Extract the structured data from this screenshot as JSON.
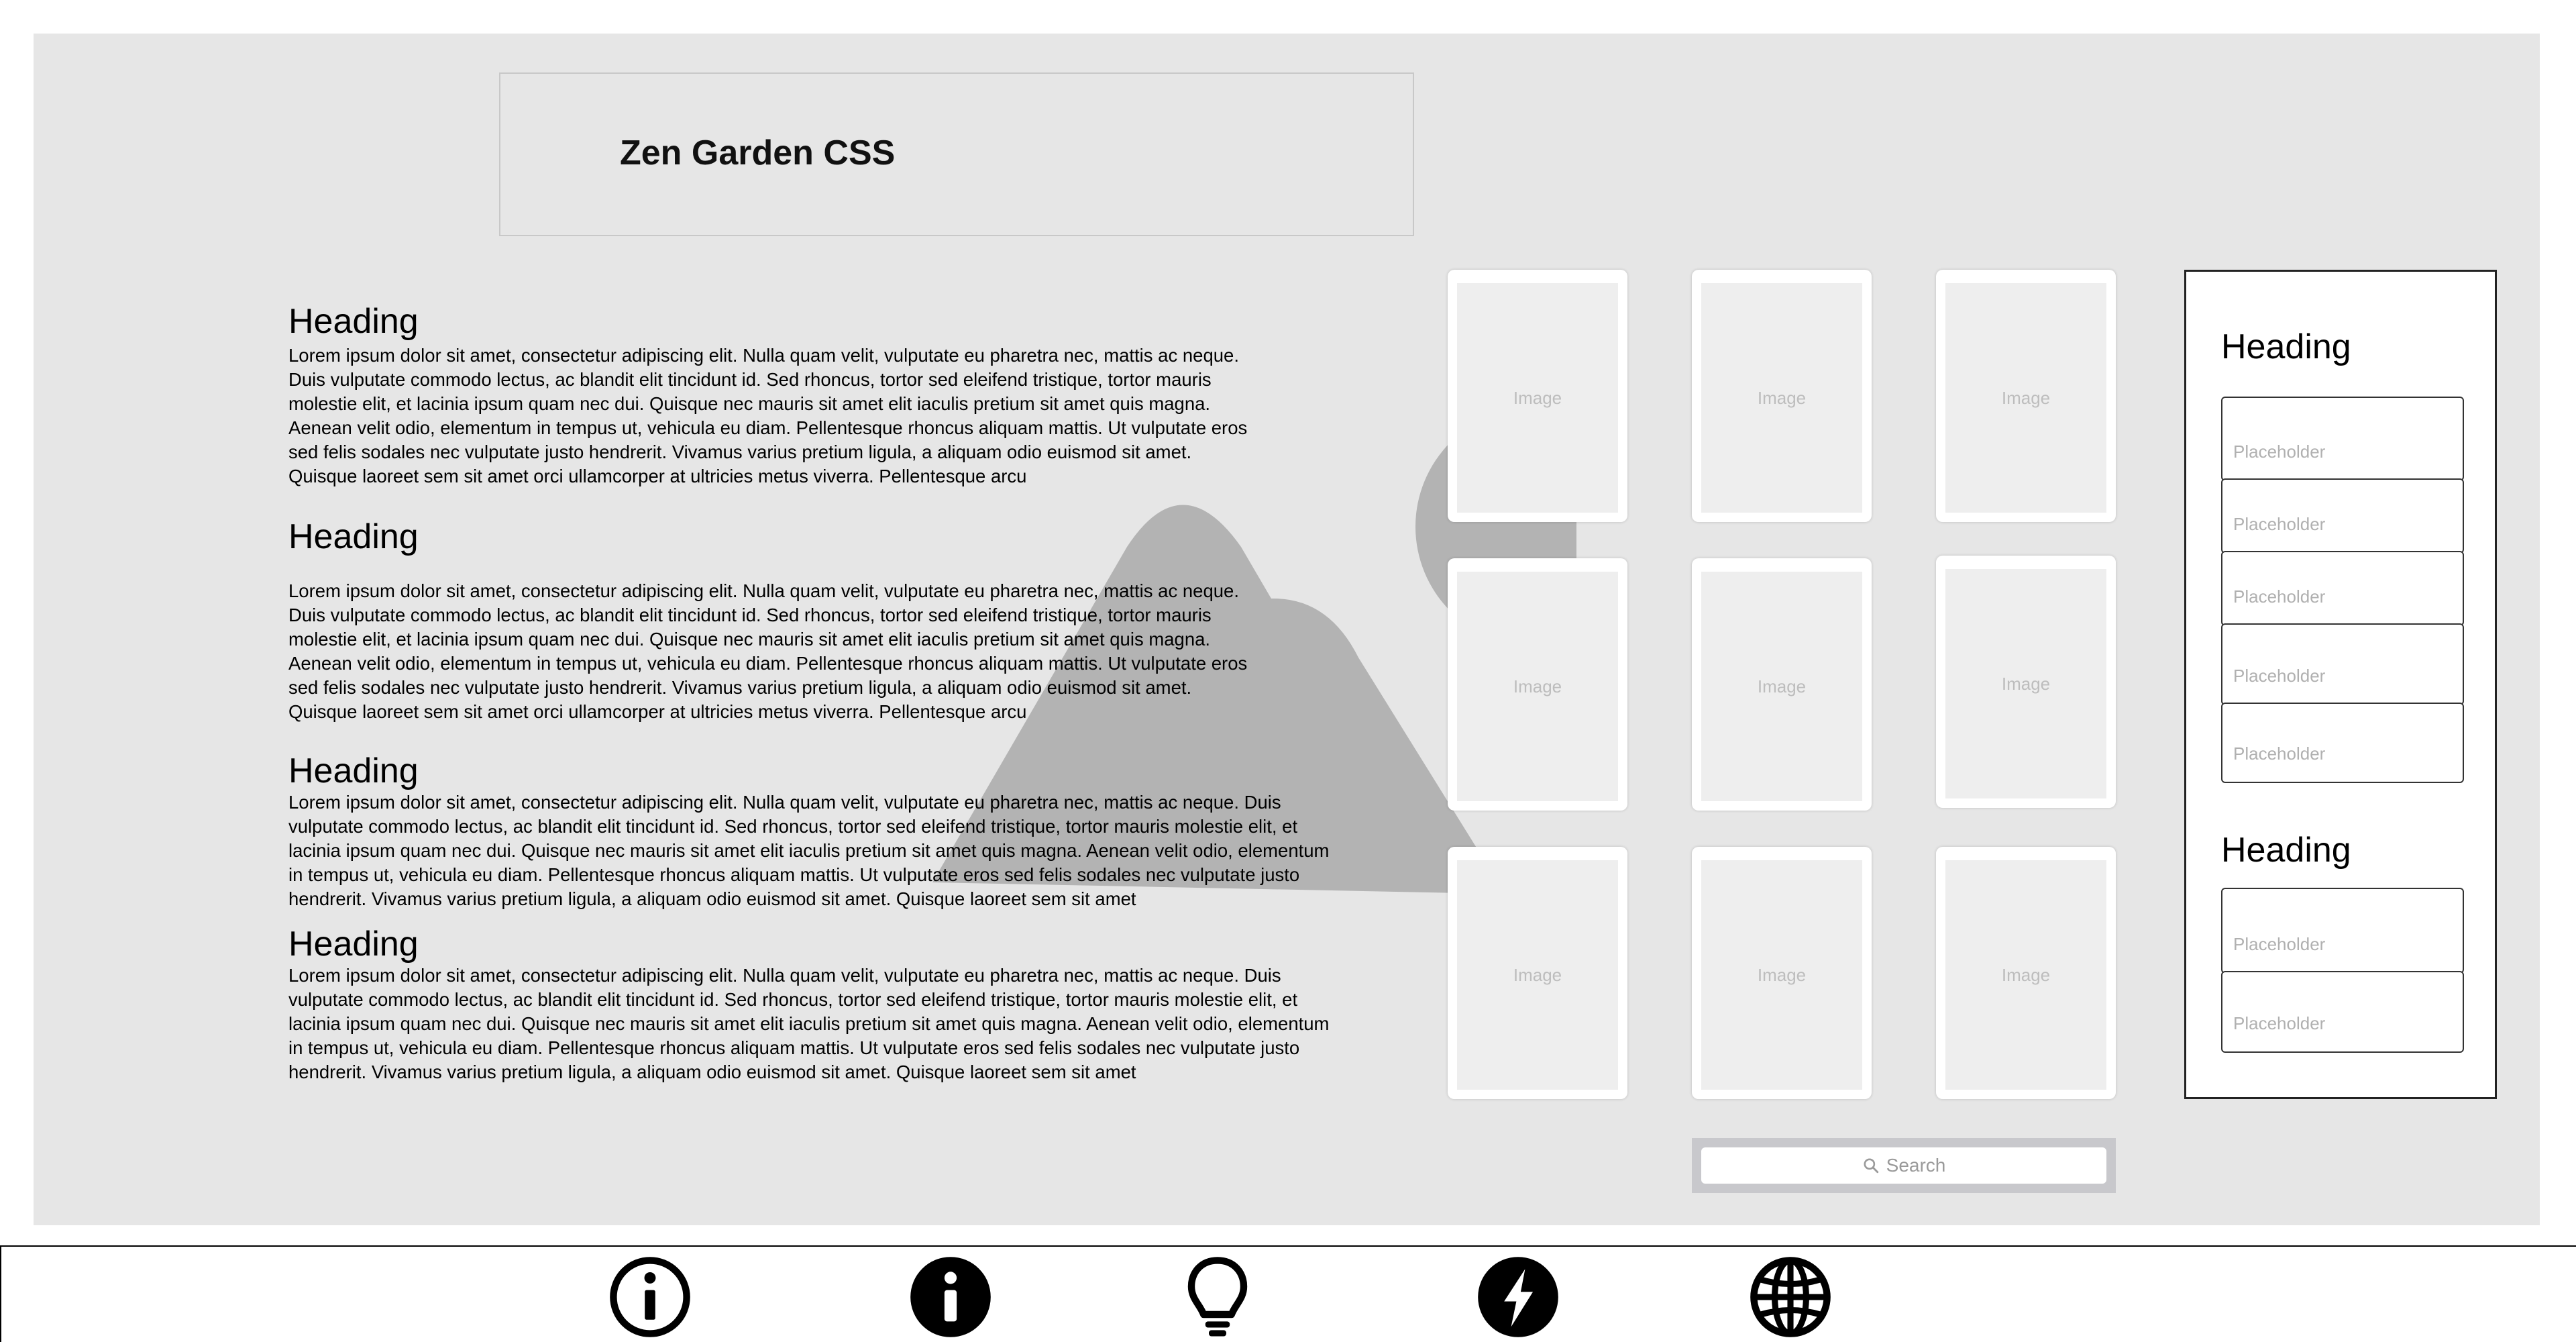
{
  "header": {
    "title": "Zen Garden CSS"
  },
  "articles": [
    {
      "heading": "Heading",
      "text": "Lorem ipsum dolor sit amet, consectetur adipiscing elit. Nulla quam velit, vulputate eu pharetra nec, mattis ac neque. Duis vulputate commodo lectus, ac blandit elit tincidunt id. Sed rhoncus, tortor sed eleifend tristique, tortor mauris molestie elit, et lacinia ipsum quam nec dui. Quisque nec mauris sit amet elit iaculis pretium sit amet quis magna. Aenean velit odio, elementum in tempus ut, vehicula eu diam. Pellentesque rhoncus aliquam mattis. Ut vulputate eros sed felis sodales nec vulputate justo hendrerit. Vivamus varius pretium ligula, a aliquam odio euismod sit amet. Quisque laoreet sem sit amet orci ullamcorper at ultricies metus viverra. Pellentesque arcu"
    },
    {
      "heading": "Heading",
      "text": "Lorem ipsum dolor sit amet, consectetur adipiscing elit. Nulla quam velit, vulputate eu pharetra nec, mattis ac neque. Duis vulputate commodo lectus, ac blandit elit tincidunt id. Sed rhoncus, tortor sed eleifend tristique, tortor mauris molestie elit, et lacinia ipsum quam nec dui. Quisque nec mauris sit amet elit iaculis pretium sit amet quis magna. Aenean velit odio, elementum in tempus ut, vehicula eu diam. Pellentesque rhoncus aliquam mattis. Ut vulputate eros sed felis sodales nec vulputate justo hendrerit. Vivamus varius pretium ligula, a aliquam odio euismod sit amet. Quisque laoreet sem sit amet orci ullamcorper at ultricies metus viverra. Pellentesque arcu"
    },
    {
      "heading": "Heading",
      "text": "Lorem ipsum dolor sit amet, consectetur adipiscing elit. Nulla quam velit, vulputate eu pharetra nec, mattis ac neque. Duis vulputate commodo lectus, ac blandit elit tincidunt id. Sed rhoncus, tortor sed eleifend tristique, tortor mauris molestie elit, et lacinia ipsum quam nec dui. Quisque nec mauris sit amet elit iaculis pretium sit amet quis magna. Aenean velit odio, elementum in tempus ut, vehicula eu diam. Pellentesque rhoncus aliquam mattis. Ut vulputate eros sed felis sodales nec vulputate justo hendrerit. Vivamus varius pretium ligula, a aliquam odio euismod sit amet. Quisque laoreet sem sit amet"
    },
    {
      "heading": "Heading",
      "text": "Lorem ipsum dolor sit amet, consectetur adipiscing elit. Nulla quam velit, vulputate eu pharetra nec, mattis ac neque. Duis vulputate commodo lectus, ac blandit elit tincidunt id. Sed rhoncus, tortor sed eleifend tristique, tortor mauris molestie elit, et lacinia ipsum quam nec dui. Quisque nec mauris sit amet elit iaculis pretium sit amet quis magna. Aenean velit odio, elementum in tempus ut, vehicula eu diam. Pellentesque rhoncus aliquam mattis. Ut vulputate eros sed felis sodales nec vulputate justo hendrerit. Vivamus varius pretium ligula, a aliquam odio euismod sit amet. Quisque laoreet sem sit amet"
    }
  ],
  "gallery": {
    "image_label": "Image",
    "count": 9
  },
  "sidebar": {
    "sections": [
      {
        "heading": "Heading",
        "items": [
          "Placeholder",
          "Placeholder",
          "Placeholder",
          "Placeholder",
          "Placeholder"
        ]
      },
      {
        "heading": "Heading",
        "items": [
          "Placeholder",
          "Placeholder"
        ]
      }
    ]
  },
  "search": {
    "placeholder": "Search",
    "icon": "search-icon"
  },
  "footer": {
    "icons": [
      "info-outline-icon",
      "info-filled-icon",
      "lightbulb-icon",
      "lightning-icon",
      "globe-icon"
    ]
  },
  "colors": {
    "page_bg": "#e6e6e6",
    "mountain": "#b3b3b3",
    "image_bg": "#eeeeee",
    "placeholder_text": "#b0b0b0"
  }
}
